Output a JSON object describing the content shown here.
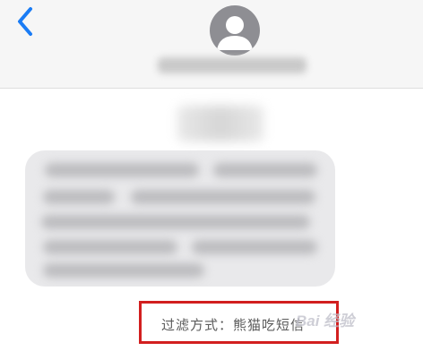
{
  "header": {
    "back_icon": "chevron-left-icon",
    "avatar_icon": "person-icon",
    "contact_name_blurred": true
  },
  "conversation": {
    "timestamp_blurred": true,
    "message_blurred": true,
    "filter_label": "过滤方式：熊猫吃短信"
  },
  "watermark": {
    "text": "Bai 经验"
  },
  "colors": {
    "accent": "#1a7cf5",
    "highlight_box": "#d21f1f",
    "avatar_bg": "#8e8e93",
    "bubble_bg": "#e9e9eb"
  }
}
